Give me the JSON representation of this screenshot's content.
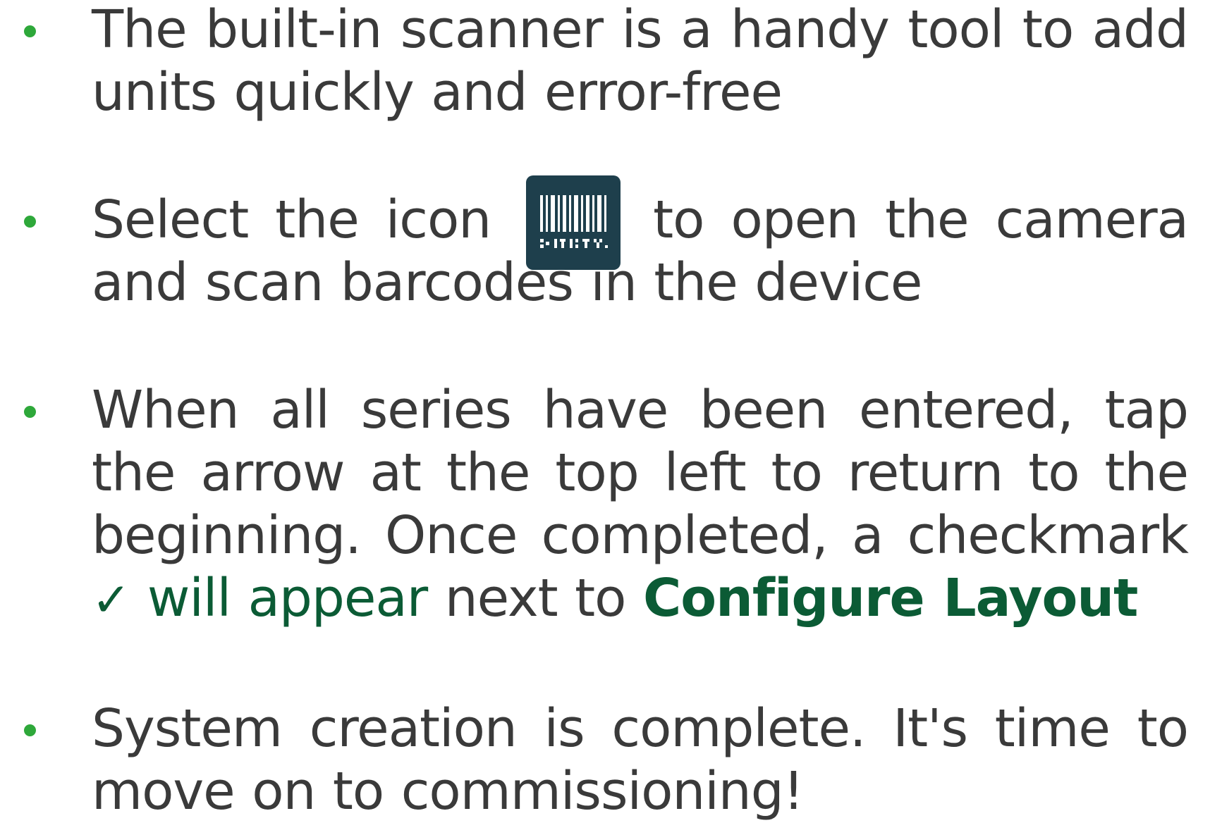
{
  "bullets": [
    {
      "text": "The built-in scanner is a handy tool to add units quickly and error-free"
    },
    {
      "before_icon": "Select the icon",
      "icon": "barcode-scanner-icon",
      "after_icon": "to open the camera and scan barcodes in the device"
    },
    {
      "text": "When all series have been entered, tap the arrow at the top left to return to the beginning. Once completed, a checkmark",
      "check_glyph": "✓",
      "green_text": "will appear",
      "middle_text": "next to",
      "bold_text": "Configure Layout"
    },
    {
      "text": "System creation is complete. It's time to move on to commissioning!"
    }
  ],
  "colors": {
    "bullet": "#2ea83a",
    "text": "#3a3a3a",
    "accent": "#0b5b35",
    "icon_bg": "#1e3f4c"
  }
}
